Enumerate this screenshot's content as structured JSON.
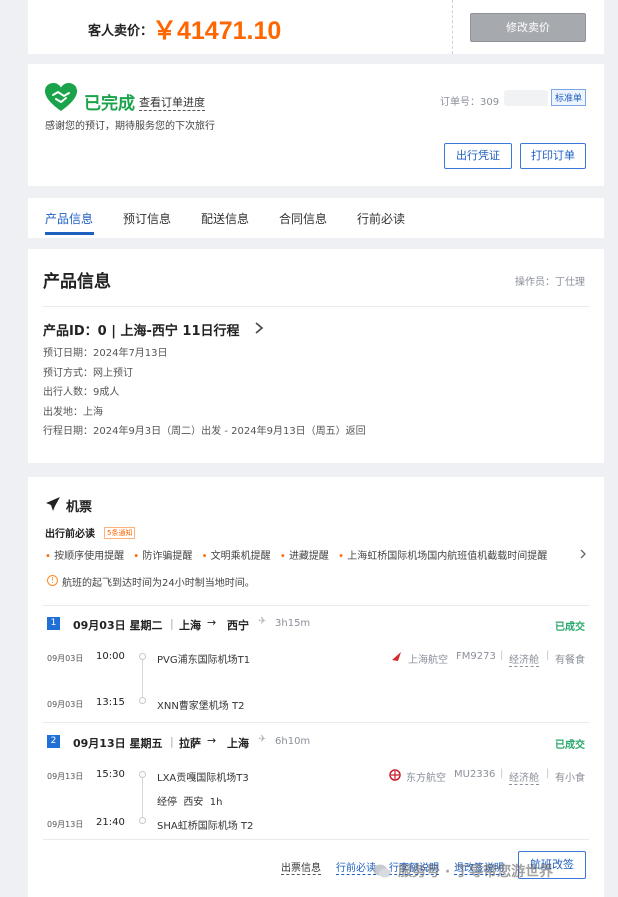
{
  "price": {
    "label": "客人卖价：",
    "value": "￥41471.10",
    "modify_btn": "修改卖价"
  },
  "status": {
    "text": "已完成",
    "progress_link": "查看订单进度",
    "thanks": "感谢您的预订，期待服务您的下次旅行",
    "order_no_label": "订单号：309",
    "order_tag": "标准单",
    "travel_voucher_btn": "出行凭证",
    "print_btn": "打印订单"
  },
  "tabs": [
    "产品信息",
    "预订信息",
    "配送信息",
    "合同信息",
    "行前必读"
  ],
  "product": {
    "title": "产品信息",
    "operator": "操作员：丁仕理",
    "id_line": "产品ID：0 | 上海-西宁 11日行程",
    "lines": [
      "预订日期：2024年7月13日",
      "预订方式：网上预订",
      "出行人数：9成人",
      "出发地：上海",
      "行程日期：2024年9月3日（周二）出发 - 2024年9月13日（周五）返回"
    ]
  },
  "flight": {
    "title": "机票",
    "must_read": "出行前必读",
    "notice_tag": "5条通知",
    "tips": [
      "按顺序使用提醒",
      "防诈骗提醒",
      "文明乘机提醒",
      "进藏提醒",
      "上海虹桥国际机场国内航班值机截载时间提醒"
    ],
    "info": "航班的起飞到达时间为24小时制当地时间。",
    "segments": [
      {
        "num": "1",
        "header": "09月03日 星期二",
        "route_from": "上海",
        "route_to": "西宁",
        "duration": "3h15m",
        "status": "已成交",
        "dep_date": "09月03日",
        "dep_time": "10:00",
        "dep_airport": "PVG浦东国际机场T1",
        "airline": "上海航空",
        "flight_no": "FM9273",
        "cabin": "经济舱",
        "meal": "有餐食",
        "arr_date": "09月03日",
        "arr_time": "13:15",
        "arr_airport": "XNN曹家堡机场 T2"
      },
      {
        "num": "2",
        "header": "09月13日 星期五",
        "route_from": "拉萨",
        "route_to": "上海",
        "duration": "6h10m",
        "status": "已成交",
        "dep_date": "09月13日",
        "dep_time": "15:30",
        "dep_airport": "LXA贡嘎国际机场T3",
        "airline": "东方航空",
        "flight_no": "MU2336",
        "cabin": "经济舱",
        "meal": "有小食",
        "stop": "经停  西安  1h",
        "arr_date": "09月13日",
        "arr_time": "21:40",
        "arr_airport": "SHA虹桥国际机场 T2"
      }
    ],
    "bottom_links": [
      "出票信息",
      "行前必读",
      "行李额说明",
      "退改签说明"
    ],
    "change_btn": "航班改签"
  },
  "watermark": "服务号 · 丁导带您游世界",
  "colors": {
    "accent": "#1f5fc0",
    "price": "#ff6600",
    "success": "#1aa34a",
    "status_green": "#2aa86b"
  }
}
